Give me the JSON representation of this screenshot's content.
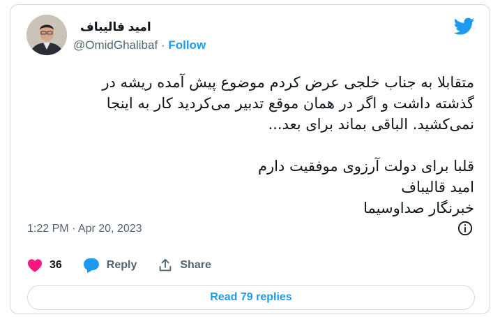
{
  "author": {
    "name": "امید قالیباف",
    "handle": "@OmidGhalibaf",
    "separator": "·",
    "follow_label": "Follow"
  },
  "tweet": {
    "lines": [
      "متقابلا به جناب خلجی عرض کردم موضوع پیش آمده ریشه در",
      "گذشته داشت و اگر در همان موقع تدبیر می‌کردید کار به اینجا",
      "نمی‌کشید. الباقی بماند برای بعد...",
      "",
      "قلبا برای دولت آرزوی موفقیت دارم",
      "امید قالیباف",
      "خبرنگار صداوسیما"
    ]
  },
  "meta": {
    "timestamp": "1:22 PM · Apr 20, 2023"
  },
  "actions": {
    "like_count": "36",
    "reply_label": "Reply",
    "share_label": "Share"
  },
  "read_replies_label": "Read 79 replies",
  "colors": {
    "accent": "#1d9bf0",
    "like": "#f91880",
    "muted": "#536471",
    "border": "#cfd9de"
  },
  "icons": [
    "twitter-bird-icon",
    "info-icon",
    "heart-icon",
    "reply-bubble-icon",
    "share-icon"
  ]
}
